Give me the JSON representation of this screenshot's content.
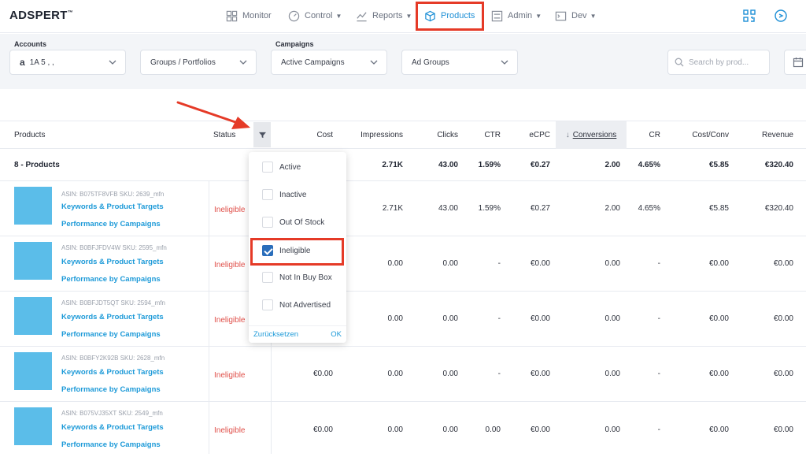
{
  "app": {
    "logo": "ADSPERT",
    "logo_mark": "™"
  },
  "nav": {
    "items": [
      {
        "label": "Monitor",
        "icon": "grid-icon",
        "caret": false
      },
      {
        "label": "Control",
        "icon": "gauge-icon",
        "caret": true
      },
      {
        "label": "Reports",
        "icon": "chart-icon",
        "caret": true
      },
      {
        "label": "Products",
        "icon": "box-icon",
        "caret": false,
        "active": true
      },
      {
        "label": "Admin",
        "icon": "sliders-icon",
        "caret": true
      },
      {
        "label": "Dev",
        "icon": "terminal-icon",
        "caret": true
      }
    ],
    "accent": "#1d8fd6",
    "highlight_color": "#e53a27"
  },
  "filters": {
    "accounts_label": "Accounts",
    "account_value": "1A 5   ,   ,",
    "groups_value": "Groups / Portfolios",
    "campaigns_label": "Campaigns",
    "campaigns_value": "Active Campaigns",
    "adgroups_value": "Ad Groups",
    "search_placeholder": "Search by prod..."
  },
  "table": {
    "headers": {
      "products": "Products",
      "status": "Status",
      "cost": "Cost",
      "impressions": "Impressions",
      "clicks": "Clicks",
      "ctr": "CTR",
      "ecpc": "eCPC",
      "conversions": "Conversions",
      "cr": "CR",
      "cost_conv": "Cost/Conv",
      "revenue": "Revenue"
    },
    "total": {
      "label": "8 - Products",
      "impressions": "2.71K",
      "clicks": "43.00",
      "ctr": "1.59%",
      "ecpc": "€0.27",
      "conversions": "2.00",
      "cr": "4.65%",
      "cost_conv": "€5.85",
      "revenue": "€320.40"
    },
    "rows": [
      {
        "asin": "ASIN: B075TF8VFB  SKU: 2639_mfn",
        "link1": "Keywords & Product Targets",
        "link2": "Performance by Campaigns",
        "status": "Ineligible",
        "cost": "",
        "impressions": "2.71K",
        "clicks": "43.00",
        "ctr": "1.59%",
        "ecpc": "€0.27",
        "conversions": "2.00",
        "cr": "4.65%",
        "cost_conv": "€5.85",
        "revenue": "€320.40"
      },
      {
        "asin": "ASIN: B0BFJFDV4W  SKU: 2595_mfn",
        "link1": "Keywords & Product Targets",
        "link2": "Performance by Campaigns",
        "status": "Ineligible",
        "cost": "",
        "impressions": "0.00",
        "clicks": "0.00",
        "ctr": "-",
        "ecpc": "€0.00",
        "conversions": "0.00",
        "cr": "-",
        "cost_conv": "€0.00",
        "revenue": "€0.00"
      },
      {
        "asin": "ASIN: B0BFJDT5QT  SKU: 2594_mfn",
        "link1": "Keywords & Product Targets",
        "link2": "Performance by Campaigns",
        "status": "Ineligible",
        "cost": "",
        "impressions": "0.00",
        "clicks": "0.00",
        "ctr": "-",
        "ecpc": "€0.00",
        "conversions": "0.00",
        "cr": "-",
        "cost_conv": "€0.00",
        "revenue": "€0.00"
      },
      {
        "asin": "ASIN: B0BFY2K92B  SKU: 2628_mfn",
        "link1": "Keywords & Product Targets",
        "link2": "Performance by Campaigns",
        "status": "Ineligible",
        "cost": "€0.00",
        "impressions": "0.00",
        "clicks": "0.00",
        "ctr": "-",
        "ecpc": "€0.00",
        "conversions": "0.00",
        "cr": "-",
        "cost_conv": "€0.00",
        "revenue": "€0.00"
      },
      {
        "asin": "ASIN: B075VJ35XT  SKU: 2549_mfn",
        "link1": "Keywords & Product Targets",
        "link2": "Performance by Campaigns",
        "status": "Ineligible",
        "cost": "€0.00",
        "impressions": "0.00",
        "clicks": "0.00",
        "ctr": "0.00",
        "ecpc": "€0.00",
        "conversions": "0.00",
        "cr": "-",
        "cost_conv": "€0.00",
        "revenue": "€0.00"
      }
    ]
  },
  "status_filter": {
    "options": [
      {
        "label": "Active",
        "checked": false
      },
      {
        "label": "Inactive",
        "checked": false
      },
      {
        "label": "Out Of Stock",
        "checked": false
      },
      {
        "label": "Ineligible",
        "checked": true
      },
      {
        "label": "Not In Buy Box",
        "checked": false
      },
      {
        "label": "Not Advertised",
        "checked": false
      }
    ],
    "reset_label": "Zurücksetzen",
    "ok_label": "OK"
  },
  "colors": {
    "link": "#1d9ad8",
    "ineligible": "#e0504a",
    "thumbnail": "#5bbde9",
    "annotation": "#e53a27"
  }
}
